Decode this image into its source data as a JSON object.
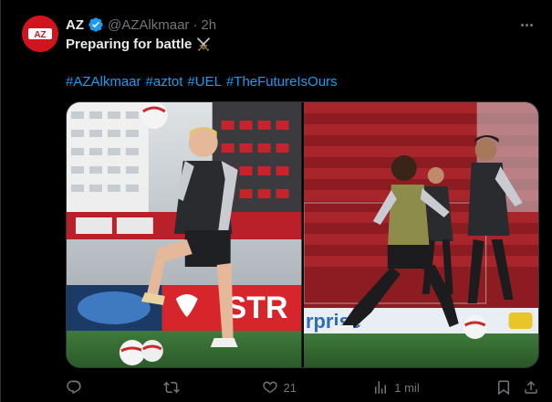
{
  "author": {
    "name": "AZ",
    "handle": "@AZAlkmaar",
    "separator": "·",
    "time": "2h",
    "avatar_text": "AZ",
    "brand_color": "#d2141e",
    "verified_color": "#1d9bf0"
  },
  "tweet": {
    "text": "Preparing for battle",
    "emoji": "crossed-swords",
    "hashtags": [
      "#AZAlkmaar",
      "#aztot",
      "#UEL",
      "#TheFutureIsOurs"
    ],
    "link_color": "#1d9bf0"
  },
  "media": {
    "photo_left": {
      "board_text": "STR"
    },
    "photo_right": {
      "board_text": "rprise"
    }
  },
  "actions": {
    "reply": {
      "icon": "reply-icon",
      "count": ""
    },
    "retweet": {
      "icon": "retweet-icon",
      "count": ""
    },
    "like": {
      "icon": "heart-icon",
      "count": "21"
    },
    "views": {
      "icon": "views-icon",
      "count": "1 mil"
    },
    "bookmark": {
      "icon": "bookmark-icon"
    },
    "share": {
      "icon": "share-icon"
    }
  }
}
